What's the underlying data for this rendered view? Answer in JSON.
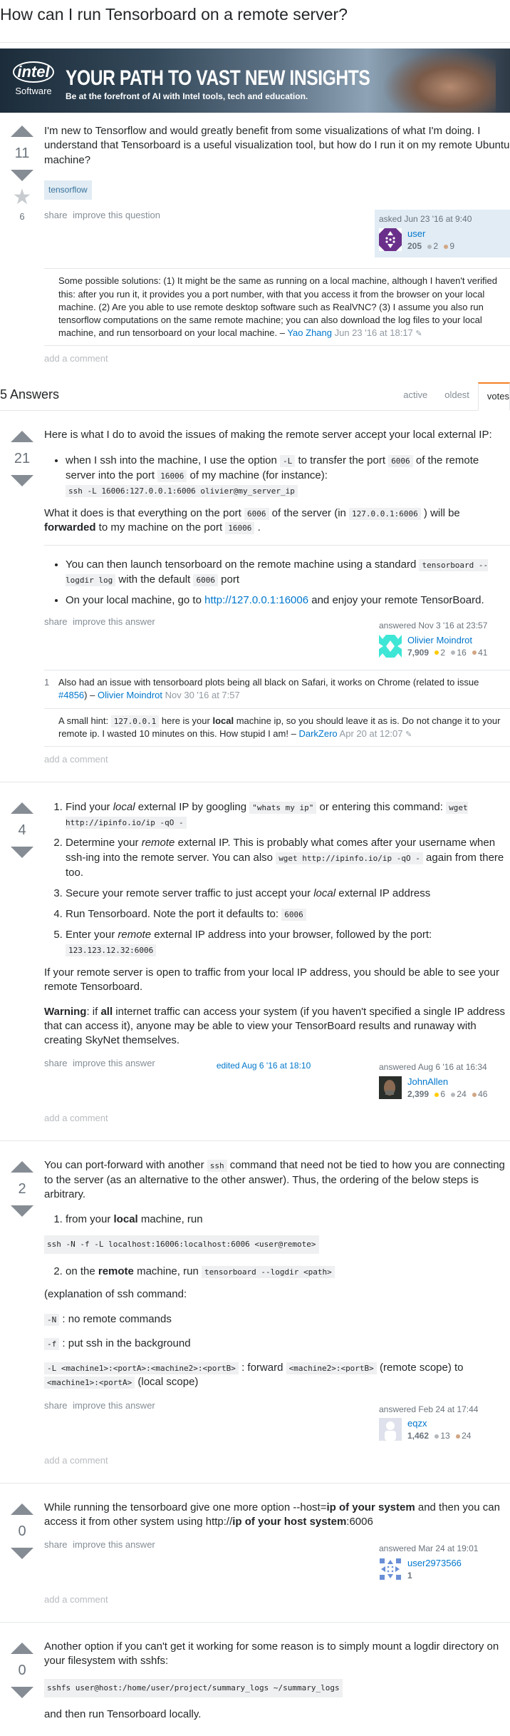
{
  "question": {
    "title": "How can I run Tensorboard on a remote server?",
    "votes": "11",
    "favorites": "6",
    "body": "I'm new to Tensorflow and would greatly benefit from some visualizations of what I'm doing. I understand that Tensorboard is a useful visualization tool, but how do I run it on my remote Ubuntu machine?",
    "tags": [
      "tensorflow"
    ],
    "menu": {
      "share": "share",
      "improve": "improve this question"
    },
    "signature": {
      "action": "asked Jun 23 '16 at 9:40",
      "user": "user",
      "rep": "205",
      "badges": {
        "silver": "2",
        "bronze": "9"
      }
    },
    "comments": [
      {
        "score": "",
        "text": "Some possible solutions: (1) It might be the same as running on a local machine, although I haven't verified this: after you run it, it provides you a port number, with that you access it from the browser on your local machine. (2) Are you able to use remote desktop software such as RealVNC? (3) I assume you also run tensorflow computations on the same remote machine; you can also download the log files to your local machine, and run tensorboard on your local machine.",
        "user": "Yao Zhang",
        "date": "Jun 23 '16 at 18:17"
      }
    ],
    "add_comment": "add a comment"
  },
  "banner": {
    "logo": "intel",
    "logo_sub": "Software",
    "headline": "YOUR PATH TO VAST NEW INSIGHTS",
    "subline": "Be at the forefront of AI with Intel tools, tech and education."
  },
  "answers_header": {
    "count_label": "5 Answers",
    "tabs": [
      {
        "label": "active",
        "selected": false
      },
      {
        "label": "oldest",
        "selected": false
      },
      {
        "label": "votes",
        "selected": true
      }
    ]
  },
  "answers": [
    {
      "votes": "21",
      "intro": "Here is what I do to avoid the issues of making the remote server accept your local external IP:",
      "b1_pre": "when I ssh into the machine, I use the option ",
      "b1_code1": "-L",
      "b1_mid1": " to transfer the port ",
      "b1_code2": "6006",
      "b1_mid2": " of the remote server into the port ",
      "b1_code3": "16006",
      "b1_mid3": " of my machine (for instance):",
      "b1_code4": "ssh -L 16006:127.0.0.1:6006 olivier@my_server_ip",
      "p2_pre": "What it does is that everything on the port ",
      "p2_code1": "6006",
      "p2_mid1": " of the server (in ",
      "p2_code2": "127.0.0.1:6006",
      "p2_mid2": " ) will be ",
      "p2_bold": "forwarded",
      "p2_mid3": " to my machine on the port ",
      "p2_code3": "16006",
      "p2_end": " .",
      "b2_pre": "You can then launch tensorboard on the remote machine using a standard ",
      "b2_code1": "tensorboard --logdir log",
      "b2_mid": " with the default ",
      "b2_code2": "6006",
      "b2_end": " port",
      "b3_pre": "On your local machine, go to ",
      "b3_link": "http://127.0.0.1:16006",
      "b3_end": " and enjoy your remote TensorBoard.",
      "menu": {
        "share": "share",
        "improve": "improve this answer"
      },
      "signature": {
        "action": "answered Nov 3 '16 at 23:57",
        "user": "Olivier Moindrot",
        "rep": "7,909",
        "badges": {
          "gold": "2",
          "silver": "16",
          "bronze": "41"
        }
      },
      "comments": [
        {
          "score": "1",
          "text": "Also had an issue with tensorboard plots being all black on Safari, it works on Chrome (related to issue ",
          "link": "#4856",
          "text_end": ")",
          "user": "Olivier Moindrot",
          "date": "Nov 30 '16 at 7:57"
        },
        {
          "score": "",
          "pre": "A small hint: ",
          "code": "127.0.0.1",
          "mid": " here is your ",
          "bold": "local",
          "end": " machine ip, so you should leave it as is. Do not change it to your remote ip. I wasted 10 minutes on this. How stupid I am!",
          "user": "DarkZero",
          "date": "Apr 20 at 12:07"
        }
      ],
      "add_comment": "add a comment"
    },
    {
      "votes": "4",
      "s1_pre": "Find your ",
      "s1_em": "local",
      "s1_mid": " external IP by googling ",
      "s1_code1": "\"whats my ip\"",
      "s1_mid2": " or entering this command: ",
      "s1_code2": "wget http://ipinfo.io/ip -qO -",
      "s2_pre": "Determine your ",
      "s2_em": "remote",
      "s2_mid": " external IP. This is probably what comes after your username when ssh-ing into the remote server. You can also ",
      "s2_code": "wget http://ipinfo.io/ip -qO -",
      "s2_end": " again from there too.",
      "s3_pre": "Secure your remote server traffic to just accept your ",
      "s3_em": "local",
      "s3_end": " external IP address",
      "s4_pre": "Run Tensorboard. Note the port it defaults to: ",
      "s4_code": "6006",
      "s5_pre": "Enter your ",
      "s5_em": "remote",
      "s5_mid": " external IP address into your browser, followed by the port: ",
      "s5_code": "123.123.12.32:6006",
      "p1": "If your remote server is open to traffic from your local IP address, you should be able to see your remote Tensorboard.",
      "warn_bold": "Warning",
      "warn_pre": ": if ",
      "warn_bold2": "all",
      "warn_end": " internet traffic can access your system (if you haven't specified a single IP address that can access it), anyone may be able to view your TensorBoard results and runaway with creating SkyNet themselves.",
      "menu": {
        "share": "share",
        "improve": "improve this answer"
      },
      "edited": "edited Aug 6 '16 at 18:10",
      "signature": {
        "action": "answered Aug 6 '16 at 16:34",
        "user": "JohnAllen",
        "rep": "2,399",
        "badges": {
          "gold": "6",
          "silver": "24",
          "bronze": "46"
        }
      },
      "add_comment": "add a comment"
    },
    {
      "votes": "2",
      "p1_pre": "You can port-forward with another ",
      "p1_code": "ssh",
      "p1_end": " command that need not be tied to how you are connecting to the server (as an alternative to the other answer). Thus, the ordering of the below steps is arbitrary.",
      "s1_pre": "from your ",
      "s1_bold": "local",
      "s1_end": " machine, run",
      "cmd1": "ssh -N -f -L localhost:16006:localhost:6006 <user@remote>",
      "s2_pre": "on the ",
      "s2_bold": "remote",
      "s2_mid": " machine, run ",
      "s2_code": "tensorboard --logdir <path>",
      "expl": "(explanation of ssh command:",
      "opt1_code": "-N",
      "opt1_text": " : no remote commands",
      "opt2_code": "-f",
      "opt2_text": " : put ssh in the background",
      "opt3_code": "-L <machine1>:<portA>:<machine2>:<portB>",
      "opt3_mid": " : forward ",
      "opt3_code2": "<machine2>:<portB>",
      "opt3_mid2": " (remote scope) to ",
      "opt3_code3": "<machine1>:<portA>",
      "opt3_end": " (local scope)",
      "menu": {
        "share": "share",
        "improve": "improve this answer"
      },
      "signature": {
        "action": "answered Feb 24 at 17:44",
        "user": "eqzx",
        "rep": "1,462",
        "badges": {
          "silver": "13",
          "bronze": "24"
        }
      },
      "add_comment": "add a comment"
    },
    {
      "votes": "0",
      "pre": "While running the tensorboard give one more option --host=",
      "bold1": "ip of your system",
      "mid": " and then you can access it from other system using http://",
      "bold2": "ip of your host system",
      "end": ":6006",
      "menu": {
        "share": "share",
        "improve": "improve this answer"
      },
      "signature": {
        "action": "answered Mar 24 at 19:01",
        "user": "user2973566",
        "rep": "1"
      },
      "add_comment": "add a comment"
    },
    {
      "votes": "0",
      "p1": "Another option if you can't get it working for some reason is to simply mount a logdir directory on your filesystem with sshfs:",
      "cmd": "sshfs user@host:/home/user/project/summary_logs ~/summary_logs",
      "p2": "and then run Tensorboard locally."
    }
  ],
  "colors": {
    "link": "#0077cc",
    "tag_bg": "#e1ecf4",
    "tag_text": "#39739d",
    "owner_bg": "#e1ecf4",
    "vote_arrow": "#858c93",
    "tab_active_border": "#f48024",
    "badge_gold": "#ffcc01",
    "badge_silver": "#b4b8bc",
    "badge_bronze": "#d1a684"
  }
}
